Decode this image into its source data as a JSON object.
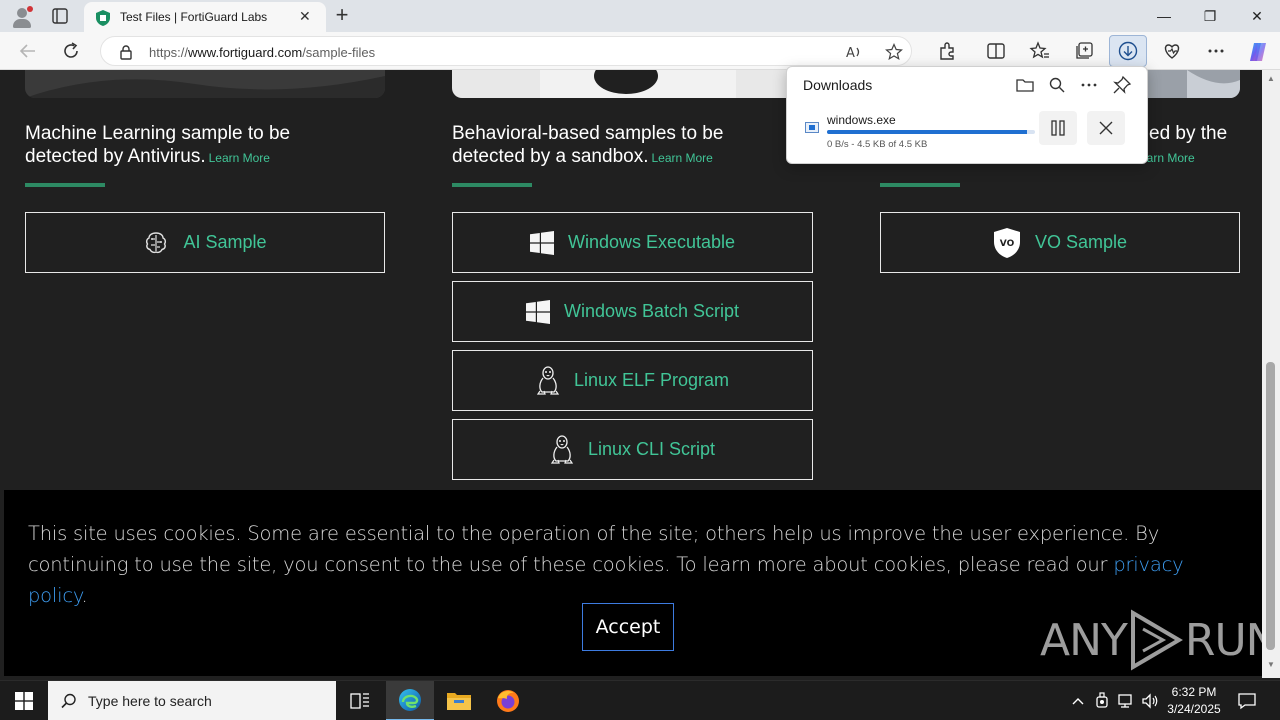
{
  "browser": {
    "tab_title": "Test Files | FortiGuard Labs",
    "url_prefix": "https://",
    "url_domain": "www.fortiguard.com",
    "url_path": "/sample-files"
  },
  "window_controls": {
    "minimize": "—",
    "restore": "❐",
    "close": "✕"
  },
  "sections": [
    {
      "title_line1": "Machine Learning sample to be",
      "title_line2": "detected by Antivirus.",
      "learn_more": "Learn More"
    },
    {
      "title_line1": "Behavioral-based samples to be",
      "title_line2": "detected by a sandbox.",
      "learn_more": "Learn More"
    },
    {
      "title_line1_partial": "ed by the",
      "learn_more_partial": "earn More"
    }
  ],
  "buttons": {
    "ai_sample": "AI Sample",
    "windows_executable": "Windows Executable",
    "windows_batch": "Windows Batch Script",
    "linux_elf": "Linux ELF Program",
    "linux_cli": "Linux CLI Script",
    "vo_sample": "VO Sample",
    "vo_badge": "VO"
  },
  "cookie": {
    "text_before": "This site uses cookies. Some are essential to the operation of the site; others help us improve the user experience. By continuing to use the site, you consent to the use of these cookies. To learn more about cookies, please read our ",
    "link": "privacy policy",
    "text_after": ".",
    "accept": "Accept"
  },
  "watermark": {
    "left": "ANY",
    "right": "RUN"
  },
  "downloads": {
    "header": "Downloads",
    "filename": "windows.exe",
    "status": "0 B/s - 4.5 KB of 4.5 KB",
    "progress": 0.96
  },
  "taskbar": {
    "search_placeholder": "Type here to search",
    "time": "6:32 PM",
    "date": "3/24/2025"
  },
  "colors": {
    "accent_green": "#41c597",
    "bar_green": "#2d8a63",
    "link_blue": "#3d9cf0",
    "download_blue": "#1f6fd1"
  }
}
